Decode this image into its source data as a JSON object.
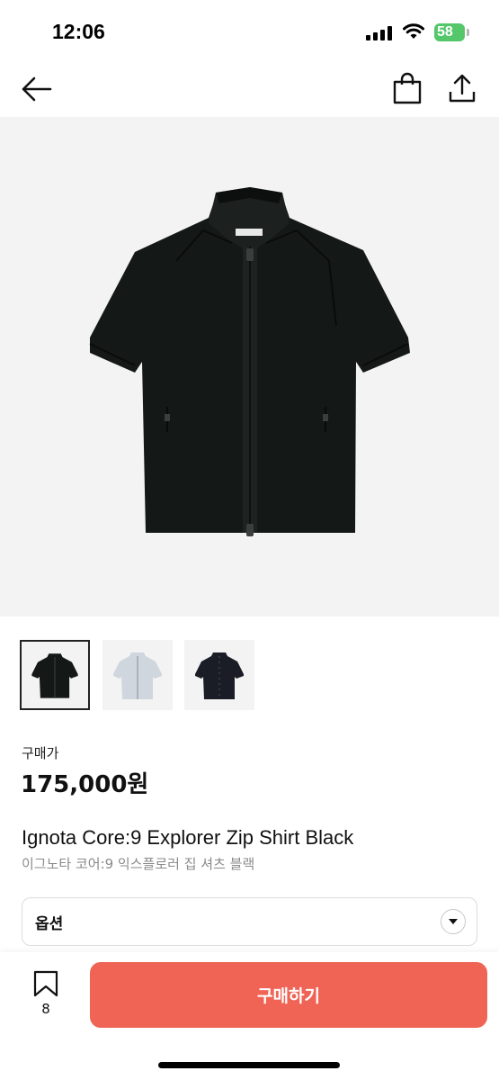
{
  "status_bar": {
    "time": "12:06",
    "battery": "58",
    "icons": [
      "signal-icon",
      "wifi-icon",
      "battery-charging-icon"
    ]
  },
  "nav": {
    "icons": [
      "back-arrow-icon",
      "shopping-bag-icon",
      "share-icon"
    ]
  },
  "product": {
    "price_label": "구매가",
    "price": "175,000원",
    "title_en": "Ignota Core:9 Explorer Zip Shirt Black",
    "title_ko": "이그노타 코어:9 익스플로러 집 셔츠 블랙",
    "thumbnails": [
      {
        "color": "black",
        "selected": true
      },
      {
        "color": "light-gray",
        "selected": false
      },
      {
        "color": "navy",
        "selected": false
      }
    ]
  },
  "option": {
    "label": "옵션"
  },
  "bottom": {
    "bookmark_count": "8",
    "buy_label": "구매하기"
  },
  "colors": {
    "accent": "#ef6455",
    "battery": "#53c76a",
    "hero_bg": "#f3f3f3"
  }
}
